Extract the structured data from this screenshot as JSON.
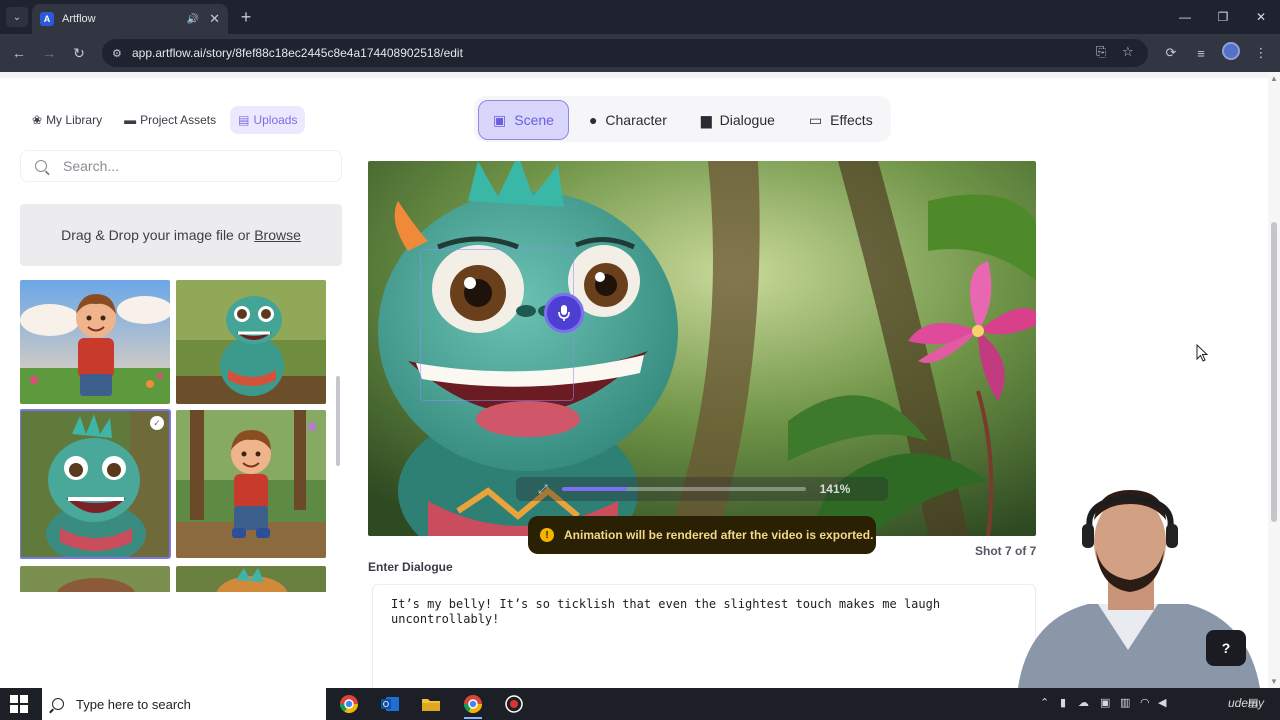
{
  "browser": {
    "tab_title": "Artflow",
    "url": "app.artflow.ai/story/8fef88c18ec2445c8e4a174408902518/edit",
    "favicon_letter": "A"
  },
  "library_tabs": [
    {
      "label": "My Library",
      "icon": "books-icon"
    },
    {
      "label": "Project Assets",
      "icon": "folder-icon"
    },
    {
      "label": "Uploads",
      "icon": "file-icon",
      "active": true
    }
  ],
  "search": {
    "placeholder": "Search..."
  },
  "dropzone": {
    "text": "Drag & Drop your image file or",
    "browse": "Browse"
  },
  "modes": [
    {
      "label": "Scene",
      "icon": "image-icon",
      "active": true
    },
    {
      "label": "Character",
      "icon": "person-icon"
    },
    {
      "label": "Dialogue",
      "icon": "chat-icon"
    },
    {
      "label": "Effects",
      "icon": "camera-icon"
    }
  ],
  "canvas": {
    "zoom": "141%",
    "zoom_fraction": 0.27
  },
  "toast": {
    "text": "Animation will be rendered after the video is exported.",
    "color": "#f4b400"
  },
  "shot": {
    "label": "Shot 7 of 7"
  },
  "dialogue": {
    "label": "Enter Dialogue",
    "text": "It’s my belly! It’s so ticklish that even the slightest touch makes me laugh uncontrollably!"
  },
  "help": {
    "label": "?"
  },
  "taskbar": {
    "search_text": "Type here to search"
  },
  "watermark": "udemy",
  "colors": {
    "accent": "#7c6ff0",
    "accent_dark": "#4c3fd2",
    "tab_active_bg": "#d9d6fb"
  }
}
